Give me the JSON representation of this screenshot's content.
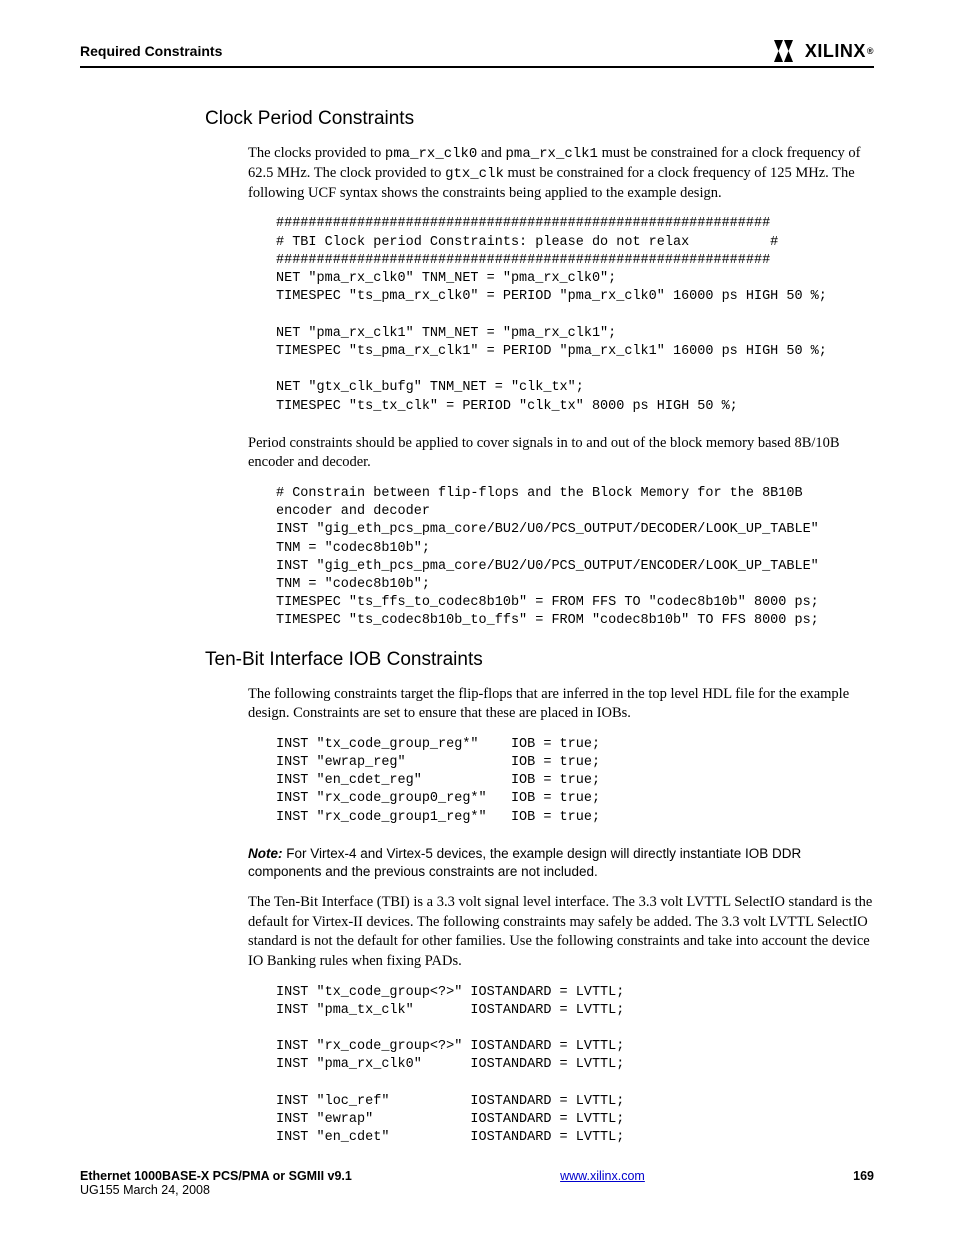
{
  "header": {
    "section": "Required Constraints",
    "brand": "XILINX"
  },
  "h1": "Clock Period Constraints",
  "p1a": "The clocks provided to ",
  "p1b": " and ",
  "p1c": " must be constrained for a clock frequency of 62.5 MHz. The clock provided to ",
  "p1d": " must be constrained for a clock frequency of 125 MHz. The following UCF syntax shows the constraints being applied to the example design.",
  "p1_m1": "pma_rx_clk0",
  "p1_m2": "pma_rx_clk1",
  "p1_m3": "gtx_clk",
  "code1": "#############################################################\n# TBI Clock period Constraints: please do not relax          #\n#############################################################\nNET \"pma_rx_clk0\" TNM_NET = \"pma_rx_clk0\";\nTIMESPEC \"ts_pma_rx_clk0\" = PERIOD \"pma_rx_clk0\" 16000 ps HIGH 50 %;\n\nNET \"pma_rx_clk1\" TNM_NET = \"pma_rx_clk1\";\nTIMESPEC \"ts_pma_rx_clk1\" = PERIOD \"pma_rx_clk1\" 16000 ps HIGH 50 %;\n\nNET \"gtx_clk_bufg\" TNM_NET = \"clk_tx\";\nTIMESPEC \"ts_tx_clk\" = PERIOD \"clk_tx\" 8000 ps HIGH 50 %;",
  "p2": "Period constraints should be applied to cover signals in to and out of the block memory based 8B/10B encoder and decoder.",
  "code2": "# Constrain between flip-flops and the Block Memory for the 8B10B\nencoder and decoder\nINST \"gig_eth_pcs_pma_core/BU2/U0/PCS_OUTPUT/DECODER/LOOK_UP_TABLE\"\nTNM = \"codec8b10b\";\nINST \"gig_eth_pcs_pma_core/BU2/U0/PCS_OUTPUT/ENCODER/LOOK_UP_TABLE\"\nTNM = \"codec8b10b\";\nTIMESPEC \"ts_ffs_to_codec8b10b\" = FROM FFS TO \"codec8b10b\" 8000 ps;\nTIMESPEC \"ts_codec8b10b_to_ffs\" = FROM \"codec8b10b\" TO FFS 8000 ps;",
  "h2": "Ten-Bit Interface IOB Constraints",
  "p3": "The following constraints target the flip-flops that are inferred in the top level HDL file for the example design. Constraints are set to ensure that these are placed in IOBs.",
  "code3": "INST \"tx_code_group_reg*\"    IOB = true;\nINST \"ewrap_reg\"             IOB = true;\nINST \"en_cdet_reg\"           IOB = true;\nINST \"rx_code_group0_reg*\"   IOB = true;\nINST \"rx_code_group1_reg*\"   IOB = true;",
  "note_label": "Note:",
  "note_text": "For Virtex-4 and Virtex-5 devices, the example design will directly instantiate IOB DDR components and the previous constraints are not included.",
  "p4": "The Ten-Bit Interface (TBI) is a 3.3 volt signal level interface. The 3.3 volt LVTTL SelectIO standard is the default for Virtex-II devices. The following constraints may safely be added. The 3.3 volt LVTTL SelectIO standard is not the default for other families. Use the following constraints and take into account the device IO Banking rules when fixing PADs.",
  "code4": "INST \"tx_code_group<?>\" IOSTANDARD = LVTTL;\nINST \"pma_tx_clk\"       IOSTANDARD = LVTTL;\n\nINST \"rx_code_group<?>\" IOSTANDARD = LVTTL;\nINST \"pma_rx_clk0\"      IOSTANDARD = LVTTL;\n\nINST \"loc_ref\"          IOSTANDARD = LVTTL;\nINST \"ewrap\"            IOSTANDARD = LVTTL;\nINST \"en_cdet\"          IOSTANDARD = LVTTL;",
  "footer": {
    "title": "Ethernet 1000BASE-X PCS/PMA or SGMII v9.1",
    "sub": "UG155 March 24, 2008",
    "link": "www.xilinx.com",
    "page": "169"
  }
}
